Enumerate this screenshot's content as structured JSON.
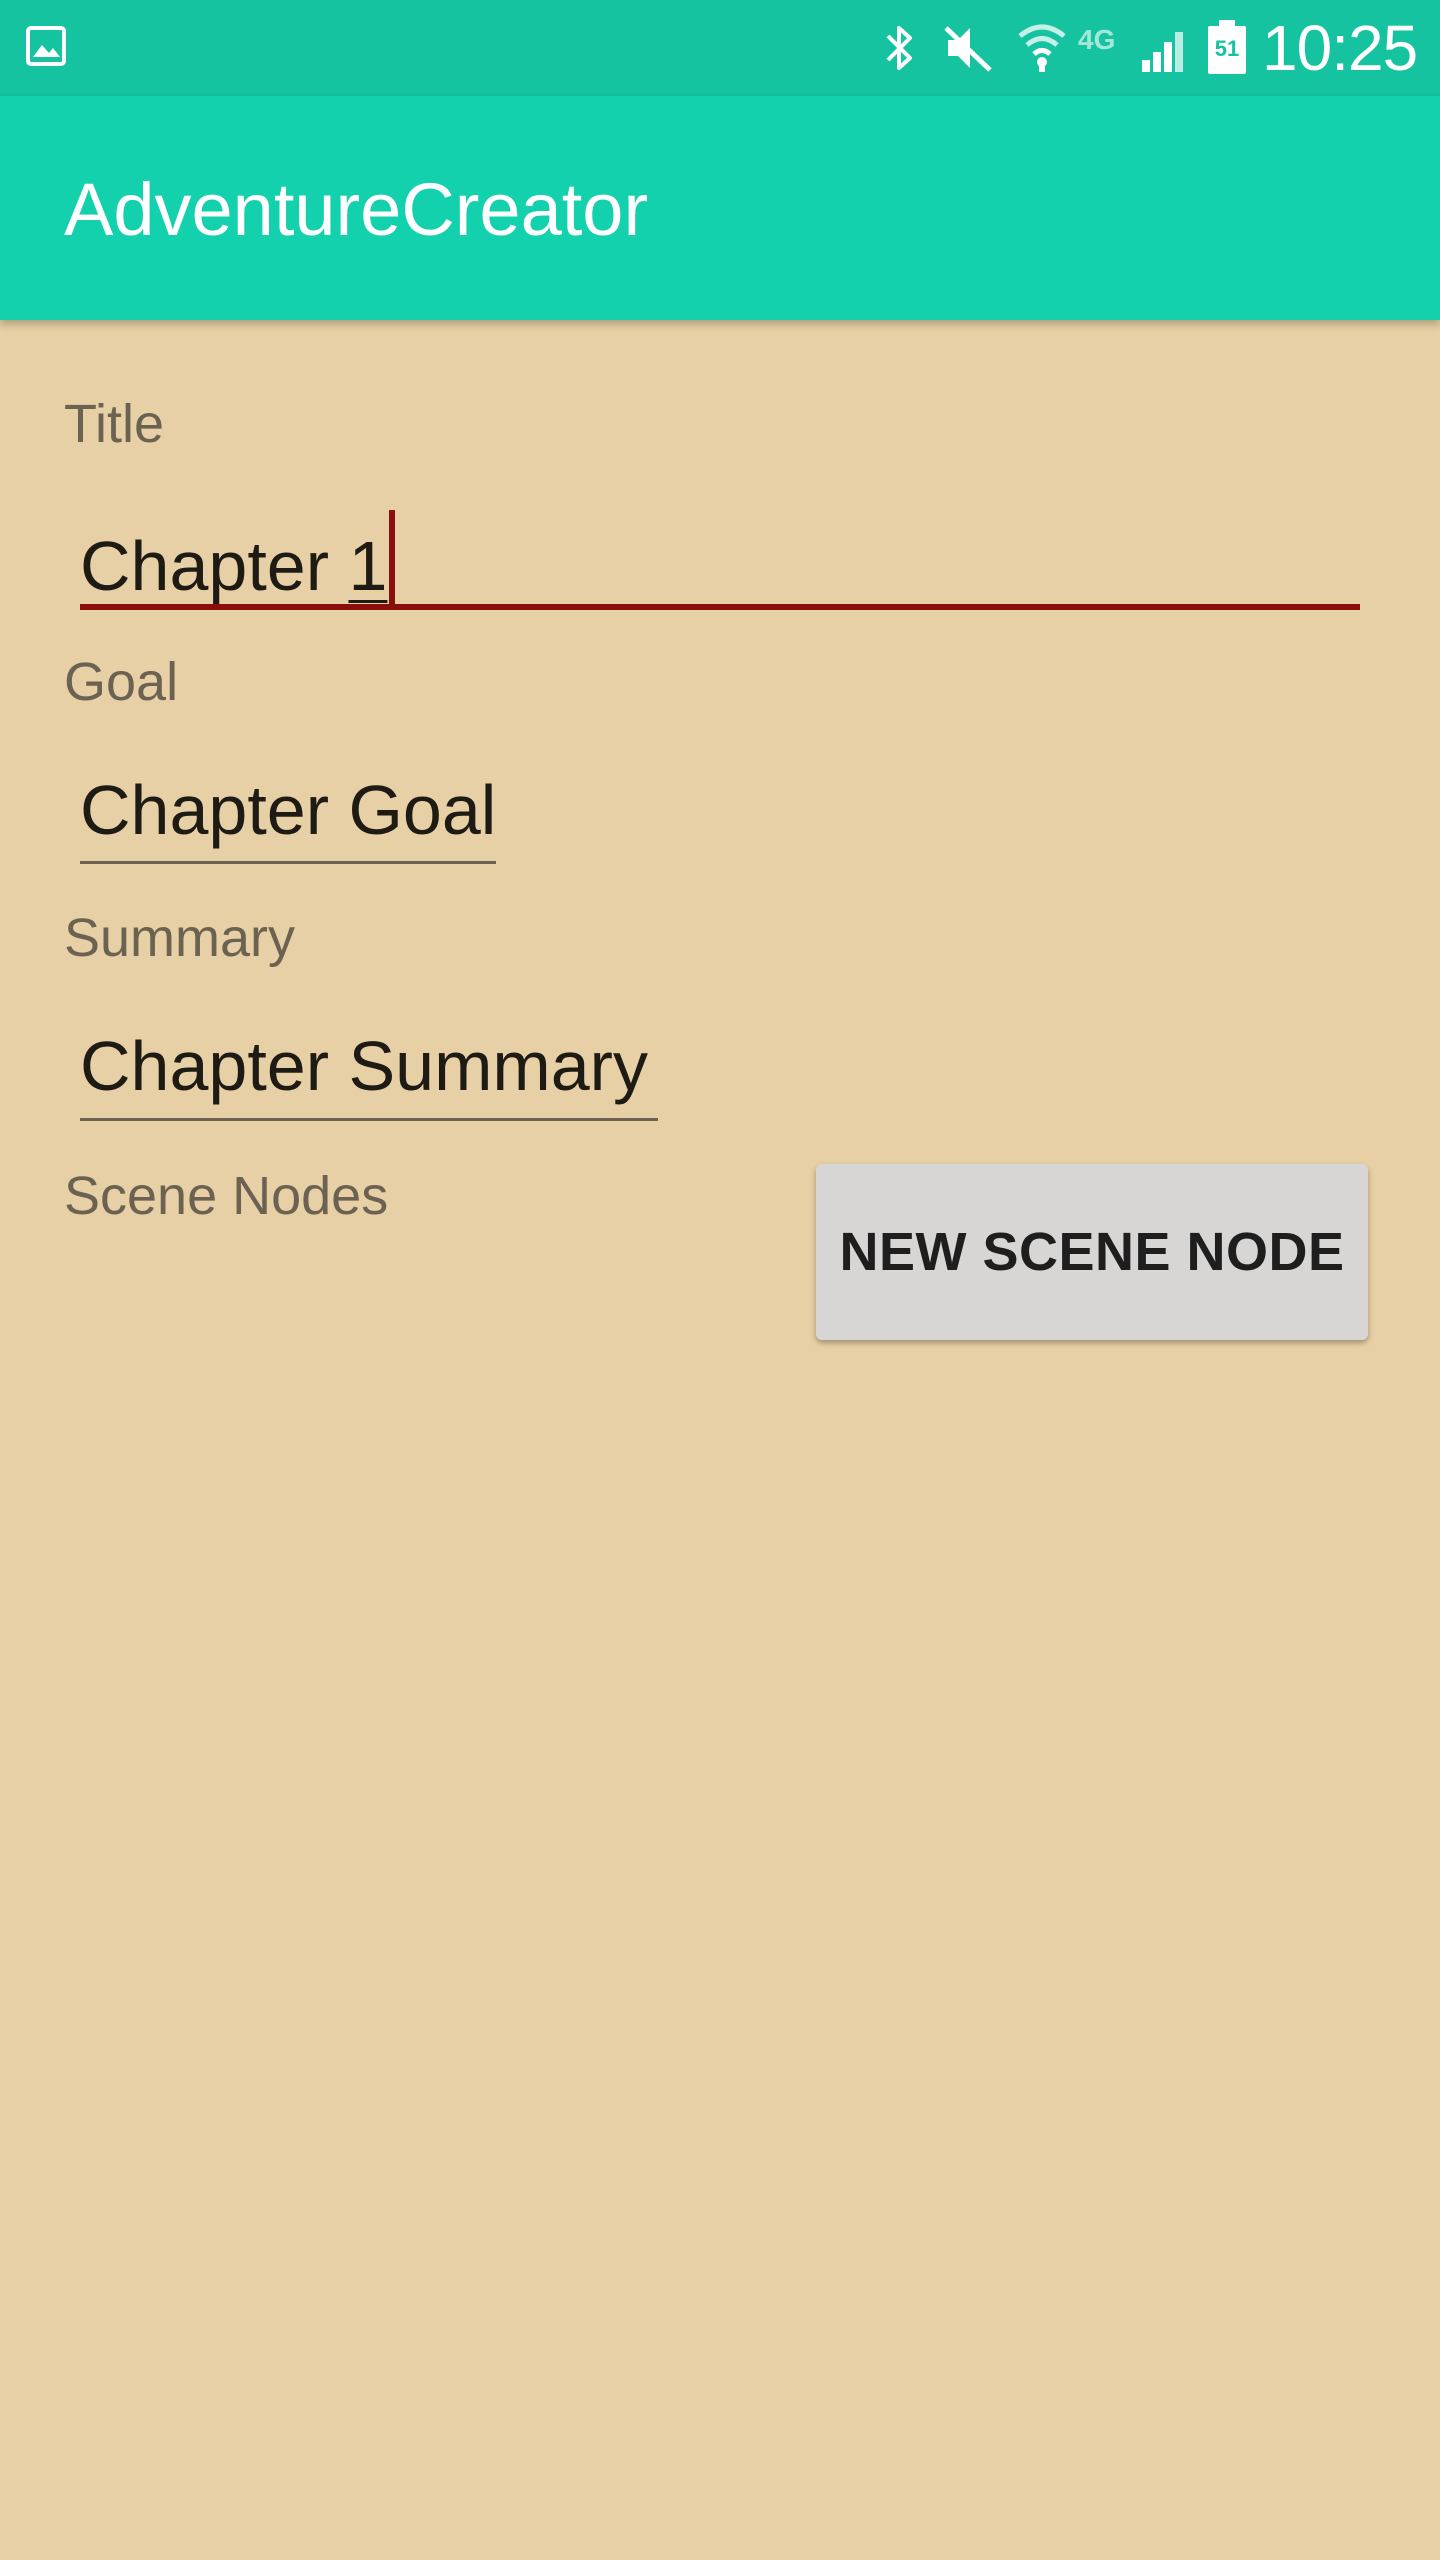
{
  "status_bar": {
    "time": "10:25",
    "battery_level": "51",
    "network_label": "4G",
    "icons": [
      "gallery-icon",
      "bluetooth-icon",
      "mute-icon",
      "wifi-icon",
      "4g-icon",
      "signal-icon",
      "battery-icon"
    ]
  },
  "app_bar": {
    "title": "AdventureCreator"
  },
  "form": {
    "title_label": "Title",
    "title_value_main": "Chapter ",
    "title_value_last": "1",
    "goal_label": "Goal",
    "goal_value": "Chapter Goal",
    "summary_label": "Summary",
    "summary_value": "Chapter Summary",
    "scene_nodes_label": "Scene Nodes"
  },
  "actions": {
    "new_scene_node_label": "NEW SCENE NODE"
  },
  "colors": {
    "status_bar": "#16c3a1",
    "app_bar": "#14d1ad",
    "background": "#e7d0a5",
    "accent": "#8a0e0b",
    "button": "#d7d6d5"
  }
}
